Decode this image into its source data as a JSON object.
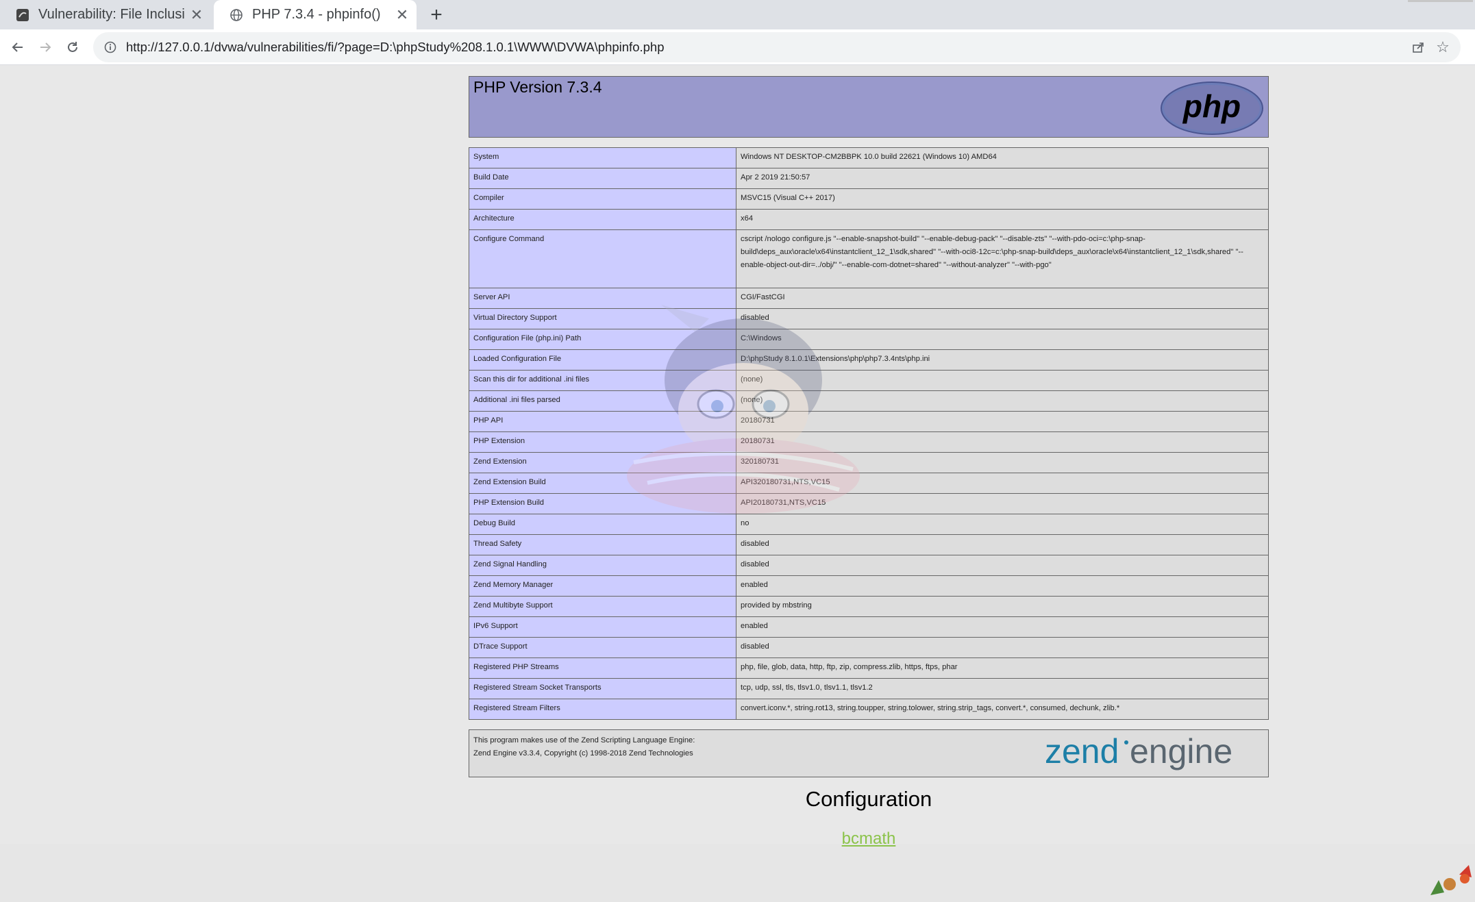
{
  "browser": {
    "tabs": [
      {
        "title": "Vulnerability: File Inclusi",
        "active": false,
        "icon": "dvwa-favicon-icon"
      },
      {
        "title": "PHP 7.3.4 - phpinfo()",
        "active": true,
        "icon": "globe-icon"
      }
    ],
    "url": "http://127.0.0.1/dvwa/vulnerabilities/fi/?page=D:\\phpStudy%208.1.0.1\\WWW\\DVWA\\phpinfo.php"
  },
  "phpinfo": {
    "title": "PHP Version 7.3.4",
    "logo_text": "php",
    "rows": [
      {
        "key": "System",
        "value": "Windows NT DESKTOP-CM2BBPK 10.0 build 22621 (Windows 10) AMD64"
      },
      {
        "key": "Build Date",
        "value": "Apr 2 2019 21:50:57"
      },
      {
        "key": "Compiler",
        "value": "MSVC15 (Visual C++ 2017)"
      },
      {
        "key": "Architecture",
        "value": "x64"
      },
      {
        "key": "Configure Command",
        "value": "cscript /nologo configure.js \"--enable-snapshot-build\" \"--enable-debug-pack\" \"--disable-zts\" \"--with-pdo-oci=c:\\php-snap-build\\deps_aux\\oracle\\x64\\instantclient_12_1\\sdk,shared\" \"--with-oci8-12c=c:\\php-snap-build\\deps_aux\\oracle\\x64\\instantclient_12_1\\sdk,shared\" \"--enable-object-out-dir=../obj/\" \"--enable-com-dotnet=shared\" \"--without-analyzer\" \"--with-pgo\""
      },
      {
        "key": "Server API",
        "value": "CGI/FastCGI"
      },
      {
        "key": "Virtual Directory Support",
        "value": "disabled"
      },
      {
        "key": "Configuration File (php.ini) Path",
        "value": "C:\\Windows"
      },
      {
        "key": "Loaded Configuration File",
        "value": "D:\\phpStudy 8.1.0.1\\Extensions\\php\\php7.3.4nts\\php.ini"
      },
      {
        "key": "Scan this dir for additional .ini files",
        "value": "(none)"
      },
      {
        "key": "Additional .ini files parsed",
        "value": "(none)"
      },
      {
        "key": "PHP API",
        "value": "20180731"
      },
      {
        "key": "PHP Extension",
        "value": "20180731"
      },
      {
        "key": "Zend Extension",
        "value": "320180731"
      },
      {
        "key": "Zend Extension Build",
        "value": "API320180731,NTS,VC15"
      },
      {
        "key": "PHP Extension Build",
        "value": "API20180731,NTS,VC15"
      },
      {
        "key": "Debug Build",
        "value": "no"
      },
      {
        "key": "Thread Safety",
        "value": "disabled"
      },
      {
        "key": "Zend Signal Handling",
        "value": "disabled"
      },
      {
        "key": "Zend Memory Manager",
        "value": "enabled"
      },
      {
        "key": "Zend Multibyte Support",
        "value": "provided by mbstring"
      },
      {
        "key": "IPv6 Support",
        "value": "enabled"
      },
      {
        "key": "DTrace Support",
        "value": "disabled"
      },
      {
        "key": "Registered PHP Streams",
        "value": "php, file, glob, data, http, ftp, zip, compress.zlib, https, ftps, phar"
      },
      {
        "key": "Registered Stream Socket Transports",
        "value": "tcp, udp, ssl, tls, tlsv1.0, tlsv1.1, tlsv1.2"
      },
      {
        "key": "Registered Stream Filters",
        "value": "convert.iconv.*, string.rot13, string.toupper, string.tolower, string.strip_tags, convert.*, consumed, dechunk, zlib.*"
      }
    ],
    "credits_line1": "This program makes use of the Zend Scripting Language Engine:",
    "credits_line2": "Zend Engine v3.3.4, Copyright (c) 1998-2018 Zend Technologies",
    "zend_logo_word1": "zend",
    "zend_logo_word2": "engine",
    "section_title": "Configuration",
    "section_link": "bcmath"
  },
  "colors": {
    "header_bg": "#9999cc",
    "key_bg": "#ccccff",
    "value_bg": "#dddddd",
    "zend_blue": "#1d7fa7",
    "zend_gray": "#5a6670",
    "link_green": "#8bc34a"
  }
}
